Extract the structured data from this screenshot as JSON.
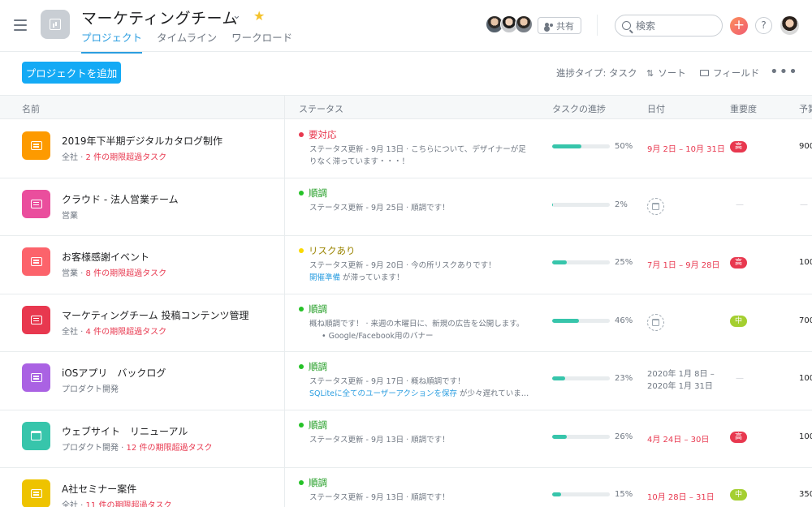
{
  "header": {
    "title": "マーケティングチーム",
    "tabs": [
      "プロジェクト",
      "タイムライン",
      "ワークロード"
    ],
    "share_label": "共有",
    "search_placeholder": "検索",
    "plus_label": "+",
    "help_label": "?"
  },
  "toolbar": {
    "add_label": "プロジェクトを追加",
    "progress_label": "進捗タイプ: タスク",
    "sort_label": "ソート",
    "fields_label": "フィールド",
    "more_label": "•••"
  },
  "columns": [
    "名前",
    "ステータス",
    "タスクの進捗",
    "日付",
    "重要度",
    "予算"
  ],
  "rows": [
    {
      "name": "2019年下半期デジタルカタログ制作",
      "team": "全社",
      "overdue": "2 件の期限超過タスク",
      "icon": "document-icon",
      "icon_color": "#fd9a00",
      "status": "要対応",
      "status_color": "#e8384f",
      "status_lines": [
        "ステータス更新 - 9月 13日 · こちらについて、デザイナーが足",
        "りなく滞っています・・・！"
      ],
      "progress": 50,
      "progress_label": "50%",
      "date": "9月 2日 – 10月 31日",
      "priority": "高",
      "priority_level": "high",
      "budget": "900"
    },
    {
      "name": "クラウド - 法人営業チーム",
      "team": "営業",
      "overdue": "",
      "icon": "document-icon",
      "icon_color": "#ea4e9d",
      "status": "順調",
      "status_color": "#25c227",
      "status_lines": [
        "ステータス更新 - 9月 25日 · 順調です！"
      ],
      "progress": 2,
      "progress_label": "2%",
      "date": "",
      "priority": "",
      "priority_level": "",
      "budget": ""
    },
    {
      "name": "お客様感謝イベント",
      "team": "営業",
      "overdue": "8 件の期限超過タスク",
      "icon": "document-icon",
      "icon_color": "#fc636b",
      "status": "リスクあり",
      "status_color": "#fad900",
      "status_lines": [
        "ステータス更新 - 9月 20日 · 今の所リスクありです！"
      ],
      "status_link": "開催準備",
      "status_link_suffix": " が滞っています！",
      "progress": 25,
      "progress_label": "25%",
      "date": "7月 1日 – 9月 28日",
      "priority": "高",
      "priority_level": "high",
      "budget": "100"
    },
    {
      "name": "マーケティングチーム 投稿コンテンツ管理",
      "team": "全社",
      "overdue": "4 件の期限超過タスク",
      "icon": "document-icon",
      "icon_color": "#e8384f",
      "status": "順調",
      "status_color": "#25c227",
      "status_lines": [
        "概ね順調です！ · 来週の木曜日に、新規の広告を公開します。"
      ],
      "status_bullet": "Google/Facebook用のバナー",
      "progress": 46,
      "progress_label": "46%",
      "date": "",
      "priority": "中",
      "priority_level": "mid",
      "budget": "700"
    },
    {
      "name": "iOSアプリ　バックログ",
      "team": "プロダクト開発",
      "overdue": "",
      "icon": "document-icon",
      "icon_color": "#aa62e3",
      "status": "順調",
      "status_color": "#25c227",
      "status_lines": [
        "ステータス更新 - 9月 17日 · 概ね順調です！"
      ],
      "status_link": "SQLiteに全てのユーザーアクションを保存",
      "status_link_suffix": " が少々遅れていま…",
      "progress": 23,
      "progress_label": "23%",
      "date_lines": [
        "2020年 1月 8日 –",
        "2020年 1月 31日"
      ],
      "priority": "",
      "priority_level": "",
      "budget": "100"
    },
    {
      "name": "ウェブサイト　リニューアル",
      "team": "プロダクト開発",
      "overdue": "12 件の期限超過タスク",
      "icon": "calendar-icon",
      "icon_color": "#37c5ab",
      "status": "順調",
      "status_color": "#25c227",
      "status_lines": [
        "ステータス更新 - 9月 13日 · 順調です！"
      ],
      "progress": 26,
      "progress_label": "26%",
      "date": "4月 24日 – 30日",
      "priority": "高",
      "priority_level": "high",
      "budget": "100"
    },
    {
      "name": "A社セミナー案件",
      "team": "全社",
      "overdue": "11 件の期限超過タスク",
      "icon": "document-icon",
      "icon_color": "#eec300",
      "status": "順調",
      "status_color": "#25c227",
      "status_lines": [
        "ステータス更新 - 9月 13日 · 順調です！"
      ],
      "progress": 15,
      "progress_label": "15%",
      "date": "10月 28日 – 31日",
      "priority": "中",
      "priority_level": "mid",
      "budget": "350"
    }
  ]
}
